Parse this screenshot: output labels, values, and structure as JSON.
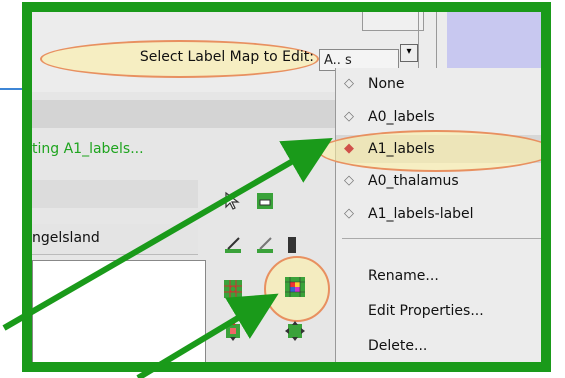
{
  "toolbar": {
    "select_label": "Select Label Map to Edit:",
    "combo_value": "A.. s",
    "combo_arrow": "▾"
  },
  "status": {
    "text": "ting A1_labels..."
  },
  "fields": {
    "name_text": "ngelsland"
  },
  "menu": {
    "items": [
      {
        "label": "None",
        "glyph": "◇"
      },
      {
        "label": "A0_labels",
        "glyph": "◇"
      },
      {
        "label": "A1_labels",
        "glyph": "◆",
        "selected": true
      },
      {
        "label": "A0_thalamus",
        "glyph": "◇"
      },
      {
        "label": "A1_labels-label",
        "glyph": "◇"
      }
    ],
    "commands": [
      {
        "label": "Rename..."
      },
      {
        "label": "Edit Properties..."
      },
      {
        "label": "Delete..."
      }
    ]
  },
  "colors": {
    "frame": "#1a9a1a",
    "arrow": "#1a9a1a",
    "highlight_oval": "#e89060",
    "status_text": "#1fa41f",
    "selected_glyph": "#d0504a"
  },
  "icons": [
    "arrow-pointer-icon",
    "eraser-icon",
    "paint-brush-icon",
    "pencil-icon",
    "grid-dot-icon",
    "grid-color-icon",
    "grid-expand-icon",
    "grid-move-icon"
  ]
}
